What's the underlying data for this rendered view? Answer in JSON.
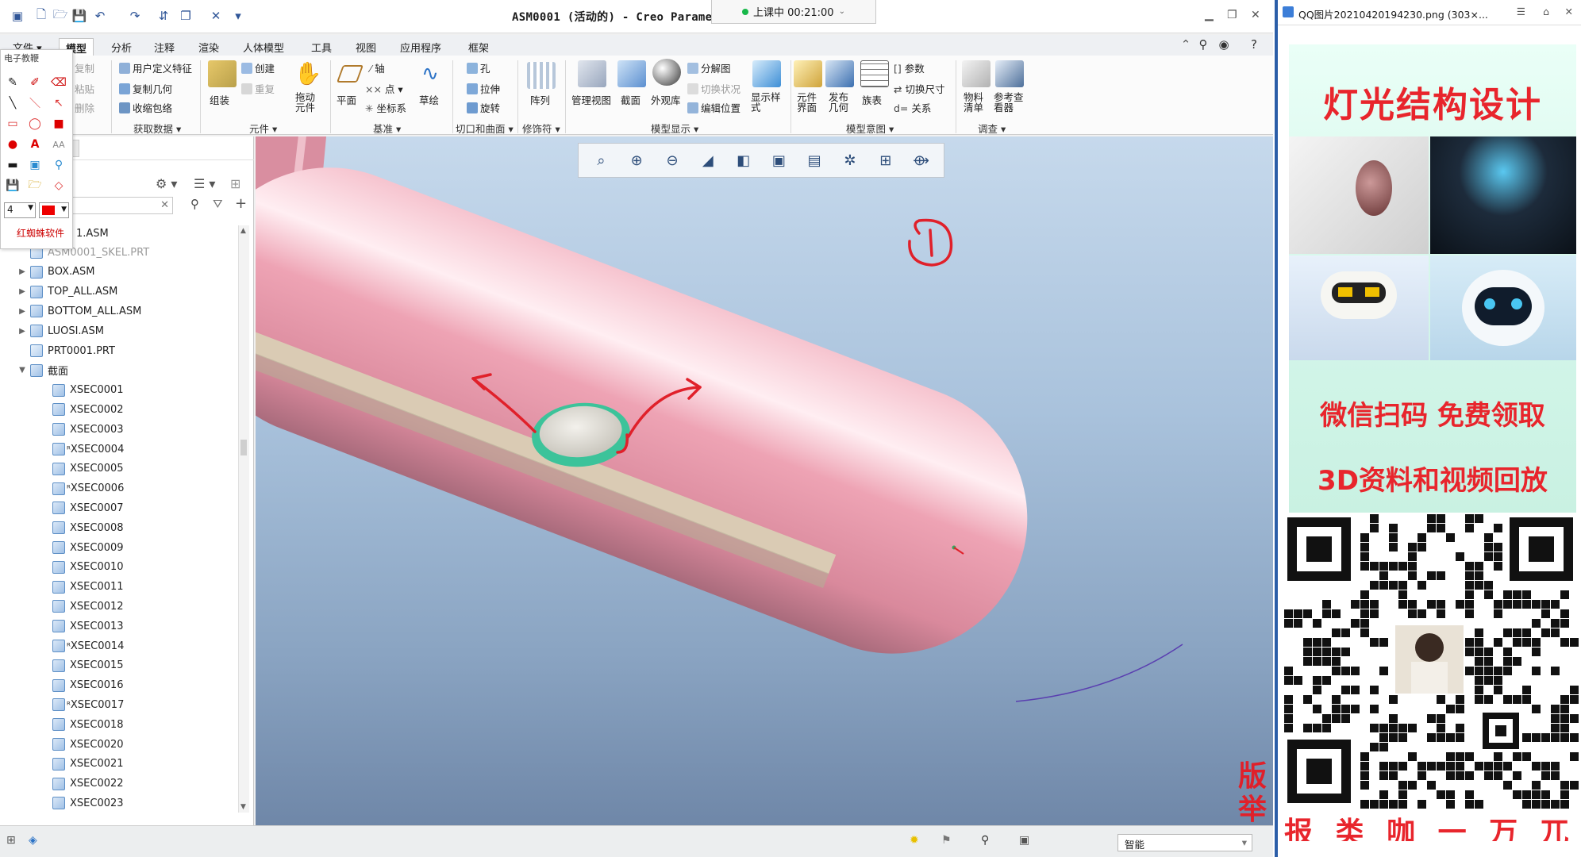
{
  "window": {
    "title": "ASM0001 (活动的) - Creo Paramet",
    "meeting_status": "上课中 00:21:00"
  },
  "menu_tabs": [
    "文件",
    "模型",
    "分析",
    "注释",
    "渲染",
    "人体模型",
    "工具",
    "视图",
    "应用程序",
    "框架"
  ],
  "active_tab": "模型",
  "ribbon": {
    "ops": {
      "copy": "复制",
      "paste": "粘贴",
      "delete": "删除"
    },
    "get_data": {
      "udf": "用户定义特征",
      "copy_geom": "复制几何",
      "shrinkwrap": "收缩包络",
      "label": "获取数据"
    },
    "components": {
      "assemble": "组装",
      "create": "创建",
      "repeat": "重复",
      "drag": "拖动元件",
      "label": "元件"
    },
    "datum": {
      "plane": "平面",
      "axis": "轴",
      "point": "点",
      "csys": "坐标系",
      "sketch": "草绘",
      "label": "基准"
    },
    "cut_surface": {
      "hole": "孔",
      "extrude": "拉伸",
      "revolve": "旋转",
      "label": "切口和曲面"
    },
    "modifiers": {
      "pattern": "阵列",
      "label": "修饰符"
    },
    "model_display": {
      "manage_views": "管理视图",
      "section": "截面",
      "appearance": "外观库",
      "exploded": "分解图",
      "toggle_status": "切换状况",
      "edit_position": "编辑位置",
      "display_style": "显示样式",
      "label": "模型显示"
    },
    "model_intent": {
      "comp_interface": "元件界面",
      "publish_geom": "发布几何",
      "family_table": "族表",
      "params": "参数",
      "switch_dims": "切换尺寸",
      "relations": "关系",
      "label": "模型意图"
    },
    "investigate": {
      "bom": "物料清单",
      "ref_viewer": "参考查看器",
      "label": "调查"
    }
  },
  "pen_toolbar": {
    "title": "电子教鞭",
    "size_value": "4",
    "brand": "红蜘蛛软件"
  },
  "model_tree": {
    "partial_root": "1.ASM",
    "items": [
      {
        "name": "ASM0001_SKEL.PRT",
        "dim": true,
        "level": 0,
        "expand": ""
      },
      {
        "name": "BOX.ASM",
        "level": 0,
        "expand": "▶"
      },
      {
        "name": "TOP_ALL.ASM",
        "level": 0,
        "expand": "▶"
      },
      {
        "name": "BOTTOM_ALL.ASM",
        "level": 0,
        "expand": "▶"
      },
      {
        "name": "LUOSI.ASM",
        "level": 0,
        "expand": "▶"
      },
      {
        "name": "PRT0001.PRT",
        "level": 0,
        "expand": ""
      },
      {
        "name": "截面",
        "level": 0,
        "expand": "▼"
      },
      {
        "name": "XSEC0001",
        "level": 1,
        "expand": ""
      },
      {
        "name": "XSEC0002",
        "level": 1,
        "expand": ""
      },
      {
        "name": "XSEC0003",
        "level": 1,
        "expand": ""
      },
      {
        "name": "XSEC0004",
        "level": 1,
        "expand": "",
        "tag": "ᴿ"
      },
      {
        "name": "XSEC0005",
        "level": 1,
        "expand": ""
      },
      {
        "name": "XSEC0006",
        "level": 1,
        "expand": "",
        "tag": "ᴿ"
      },
      {
        "name": "XSEC0007",
        "level": 1,
        "expand": ""
      },
      {
        "name": "XSEC0008",
        "level": 1,
        "expand": ""
      },
      {
        "name": "XSEC0009",
        "level": 1,
        "expand": ""
      },
      {
        "name": "XSEC0010",
        "level": 1,
        "expand": ""
      },
      {
        "name": "XSEC0011",
        "level": 1,
        "expand": ""
      },
      {
        "name": "XSEC0012",
        "level": 1,
        "expand": ""
      },
      {
        "name": "XSEC0013",
        "level": 1,
        "expand": ""
      },
      {
        "name": "XSEC0014",
        "level": 1,
        "expand": "",
        "tag": "ᴿ"
      },
      {
        "name": "XSEC0015",
        "level": 1,
        "expand": ""
      },
      {
        "name": "XSEC0016",
        "level": 1,
        "expand": ""
      },
      {
        "name": "XSEC0017",
        "level": 1,
        "expand": "",
        "tag": "ᴿ"
      },
      {
        "name": "XSEC0018",
        "level": 1,
        "expand": ""
      },
      {
        "name": "XSEC0020",
        "level": 1,
        "expand": ""
      },
      {
        "name": "XSEC0021",
        "level": 1,
        "expand": ""
      },
      {
        "name": "XSEC0022",
        "level": 1,
        "expand": ""
      },
      {
        "name": "XSEC0023",
        "level": 1,
        "expand": ""
      }
    ]
  },
  "status": {
    "filter": "智能",
    "side_chars": [
      "版",
      "举"
    ]
  },
  "viewer": {
    "title": "QQ图片20210420194230.png (303×...",
    "poster_title": "灯光结构设计",
    "slogan1": "微信扫码 免费领取",
    "slogan2": "3D资料和视频回放",
    "bottom_text": "报 类 咖 一 万 兀"
  },
  "colors": {
    "accent": "#2b5ea8",
    "model_pink": "#e89aaa",
    "annotation_red": "#e0202a",
    "poster_red": "#e8252c"
  }
}
